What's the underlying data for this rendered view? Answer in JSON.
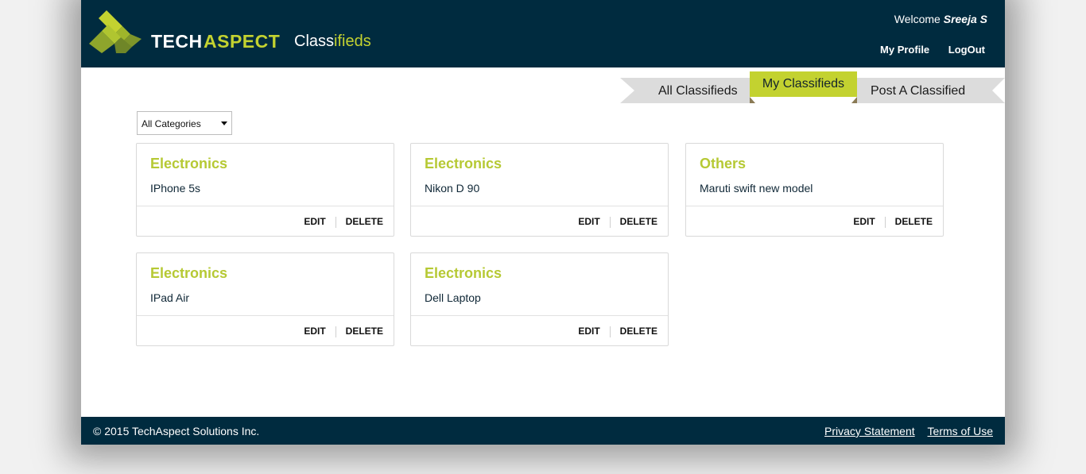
{
  "header": {
    "brand": {
      "tech": "TECH",
      "aspect": "ASPECT",
      "product_plain": "Class",
      "product_accent": "ifieds"
    },
    "welcome_prefix": "Welcome",
    "user_name": "Sreeja S",
    "links": {
      "profile": "My Profile",
      "logout": "LogOut"
    }
  },
  "tabs": {
    "all": "All Classifieds",
    "mine": "My Classifieds",
    "post": "Post A Classified",
    "active": "My Classifieds"
  },
  "filter": {
    "selected": "All Categories"
  },
  "cards": [
    {
      "category": "Electronics",
      "title": "IPhone 5s",
      "edit": "EDIT",
      "delete": "DELETE"
    },
    {
      "category": "Electronics",
      "title": "Nikon D 90",
      "edit": "EDIT",
      "delete": "DELETE"
    },
    {
      "category": "Others",
      "title": "Maruti swift new model",
      "edit": "EDIT",
      "delete": "DELETE"
    },
    {
      "category": "Electronics",
      "title": "IPad Air",
      "edit": "EDIT",
      "delete": "DELETE"
    },
    {
      "category": "Electronics",
      "title": "Dell Laptop",
      "edit": "EDIT",
      "delete": "DELETE"
    }
  ],
  "footer": {
    "copyright": "© 2015 TechAspect Solutions Inc.",
    "privacy": "Privacy Statement",
    "terms": "Terms of Use"
  },
  "colors": {
    "header_bg": "#002b3f",
    "accent": "#c3d230",
    "tab_inactive": "#dcdcdc"
  }
}
